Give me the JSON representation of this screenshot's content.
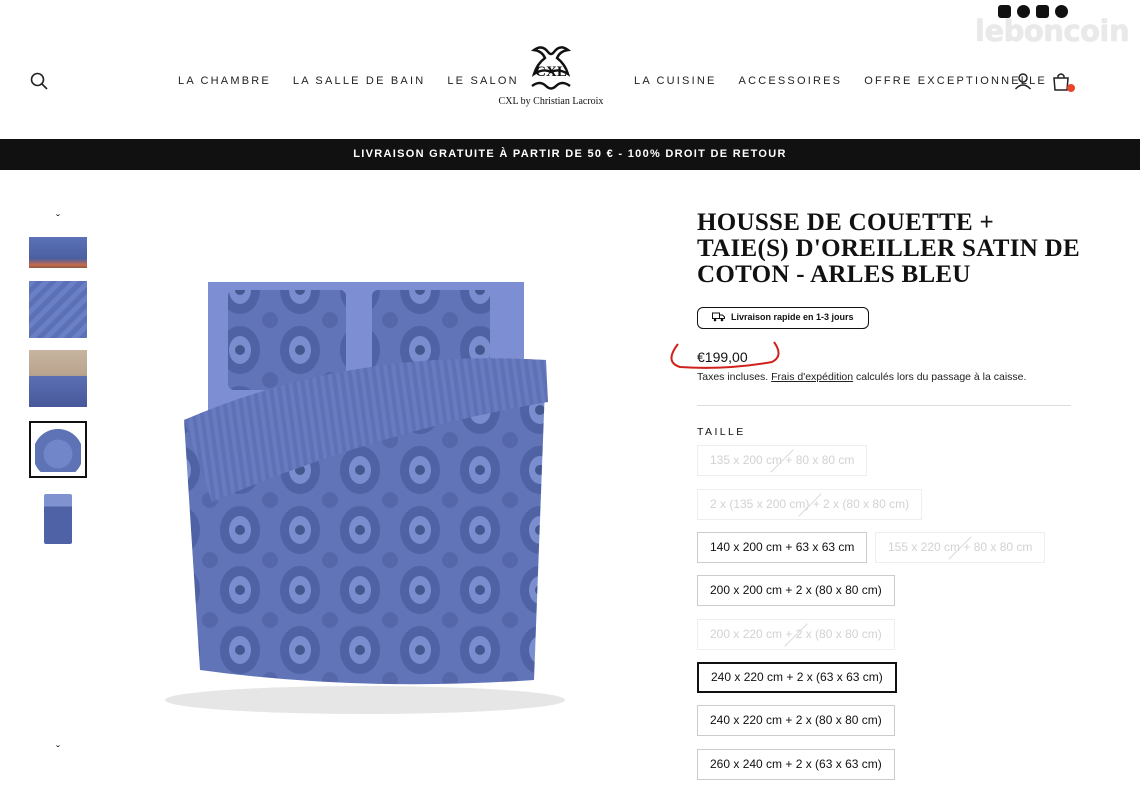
{
  "header": {
    "nav_left": [
      "LA CHAMBRE",
      "LA SALLE DE BAIN",
      "LE SALON"
    ],
    "nav_right": [
      "LA CUISINE",
      "ACCESSOIRES",
      "OFFRE EXCEPTIONNELLE"
    ],
    "logo_text": "CXL by Christian Lacroix",
    "logo_monogram": "CXL",
    "watermark": "leboncoin",
    "social_icons": [
      "instagram-icon",
      "facebook-icon",
      "youtube-icon",
      "pinterest-icon"
    ],
    "icons": [
      "search-icon",
      "user-icon",
      "cart-icon"
    ]
  },
  "announcement": "LIVRAISON GRATUITE À PARTIR DE 50 € - 100% DROIT DE RETOUR",
  "product": {
    "title": "HOUSSE DE COUETTE + TAIE(S) D'OREILLER SATIN DE COTON - ARLES BLEU",
    "delivery_badge": "Livraison rapide en 1-3 jours",
    "price": "€199,00",
    "tax_note_prefix": "Taxes incluses. ",
    "tax_note_link": "Frais d'expédition",
    "tax_note_suffix": " calculés lors du passage à la caisse.",
    "size_label": "TAILLE",
    "sizes": [
      {
        "label": "135 x 200 cm + 80 x 80 cm",
        "available": false,
        "selected": false
      },
      {
        "label": "2 x (135 x 200 cm) + 2 x (80 x 80 cm)",
        "available": false,
        "selected": false
      },
      {
        "label": "140 x 200 cm + 63 x 63 cm",
        "available": true,
        "selected": false
      },
      {
        "label": "155 x 220 cm + 80 x 80 cm",
        "available": false,
        "selected": false
      },
      {
        "label": "200 x 200 cm + 2 x (80 x 80 cm)",
        "available": true,
        "selected": false
      },
      {
        "label": "200 x 220 cm + 2 x (80 x 80 cm)",
        "available": false,
        "selected": false
      },
      {
        "label": "240 x 220 cm + 2 x (63 x 63 cm)",
        "available": true,
        "selected": true
      },
      {
        "label": "240 x 220 cm + 2 x (80 x 80 cm)",
        "available": true,
        "selected": false
      },
      {
        "label": "260 x 240 cm + 2 x (63 x 63 cm)",
        "available": true,
        "selected": false
      }
    ]
  },
  "colors": {
    "announcement_bg": "#111111",
    "product_blue": "#5c6fb4",
    "cart_badge": "#e8452c",
    "price_annotation": "#d0201c"
  }
}
